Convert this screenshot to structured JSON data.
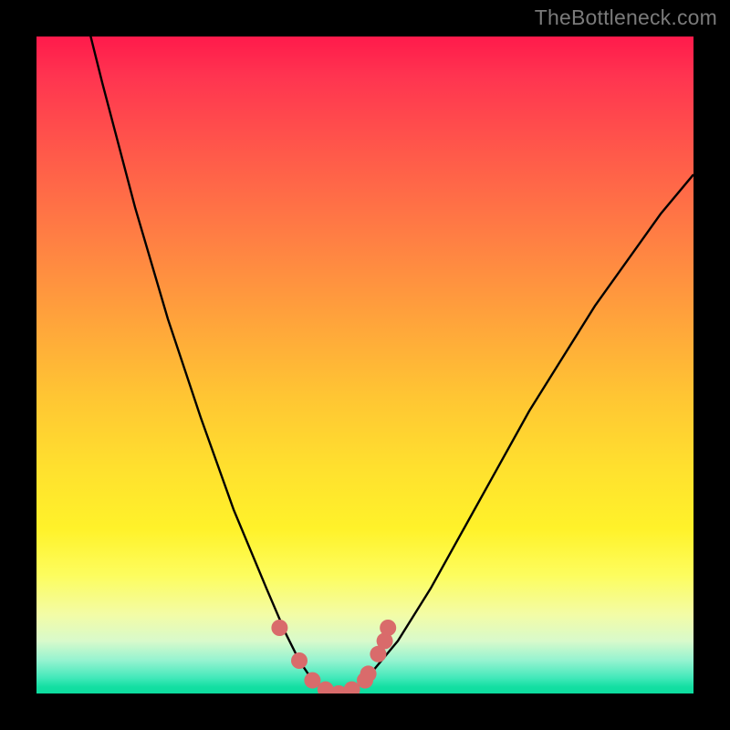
{
  "watermark": "TheBottleneck.com",
  "chart_data": {
    "type": "line",
    "title": "",
    "xlabel": "",
    "ylabel": "",
    "xlim": [
      0,
      100
    ],
    "ylim": [
      0,
      100
    ],
    "grid": false,
    "legend": false,
    "series": [
      {
        "name": "bottleneck-curve",
        "x": [
          0,
          5,
          10,
          15,
          20,
          25,
          30,
          35,
          38,
          40,
          42,
          44,
          46,
          48,
          50,
          55,
          60,
          65,
          70,
          75,
          80,
          85,
          90,
          95,
          100
        ],
        "y": [
          134,
          113,
          93,
          74,
          57,
          42,
          28,
          16,
          9,
          5,
          2,
          0.5,
          0,
          0.5,
          2,
          8,
          16,
          25,
          34,
          43,
          51,
          59,
          66,
          73,
          79
        ]
      },
      {
        "name": "highlight-dots",
        "x": [
          37,
          40,
          42,
          44,
          46,
          48,
          50,
          50.5,
          52,
          53,
          53.5
        ],
        "y": [
          10,
          5,
          2,
          0.6,
          0,
          0.6,
          2,
          3,
          6,
          8,
          10
        ]
      }
    ],
    "colors": {
      "curve": "#000000",
      "dots": "#d96b6b",
      "gradient_top": "#ff1a4b",
      "gradient_bottom": "#0ddc9f"
    },
    "annotations": []
  }
}
